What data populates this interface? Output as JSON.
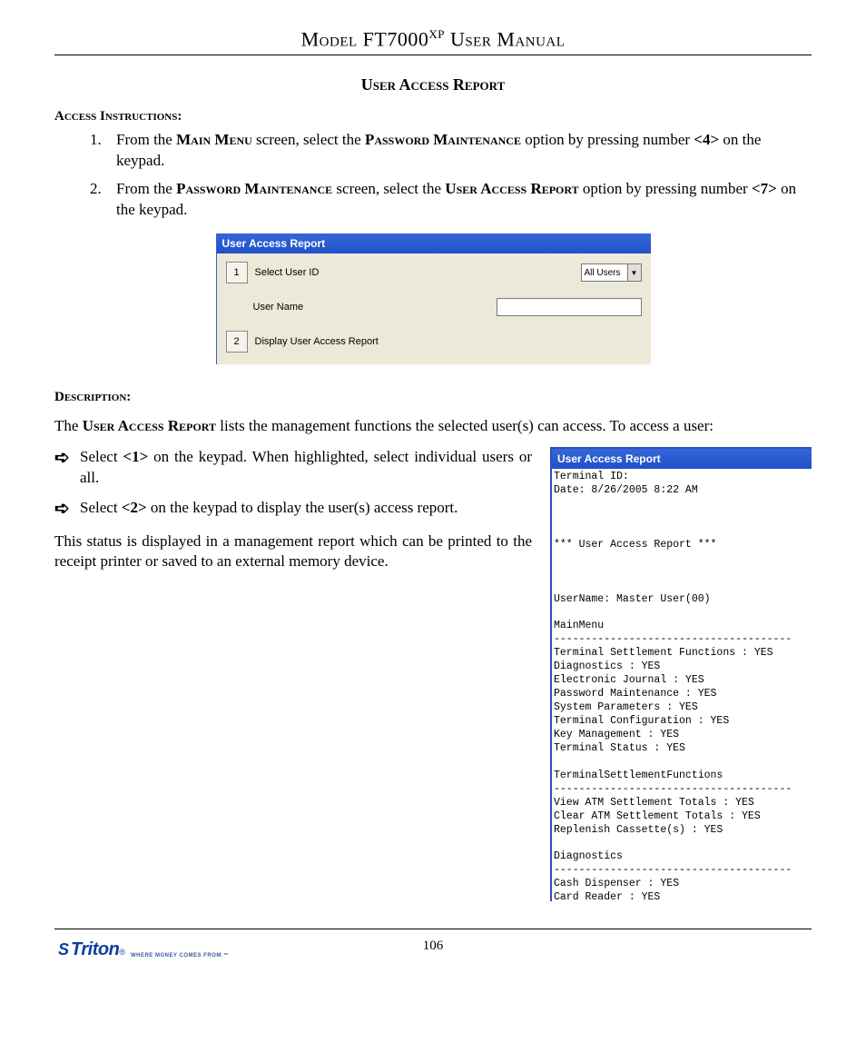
{
  "doc_title_prefix": "Model FT7000",
  "doc_title_super": "XP",
  "doc_title_suffix": " User Manual",
  "section_title": "User Access Report",
  "access_instructions_heading": "Access Instructions:",
  "instructions": [
    {
      "pre": "From the ",
      "sc1": "Main Menu",
      "mid1": " screen, select the ",
      "sc2": "Password Maintenance",
      "mid2": " option by pressing number ",
      "key": "<4>",
      "post": " on the keypad."
    },
    {
      "pre": "From the ",
      "sc1": "Password Maintenance",
      "mid1": " screen, select the ",
      "sc2": "User Access Report",
      "mid2": " option by pressing number ",
      "key": "<7>",
      "post": " on the keypad."
    }
  ],
  "dialog1": {
    "title": "User Access Report",
    "btn1_num": "1",
    "btn1_label": "Select User ID",
    "dropdown_value": "All Users",
    "username_label": "User Name",
    "username_value": "",
    "btn2_num": "2",
    "btn2_label": "Display User Access Report"
  },
  "description_heading": "Description:",
  "desc_line_pre": "The ",
  "desc_line_sc": "User Access Report",
  "desc_line_post": " lists the management functions the selected user(s) can access. To access a user:",
  "bullets": [
    {
      "pre": "Select ",
      "key": "<1>",
      "post": " on the keypad. When highlighted, select individual users or all."
    },
    {
      "pre": "Select ",
      "key": "<2>",
      "post": " on the keypad to display the user(s) access report."
    }
  ],
  "body_para": "This status is displayed in a management report  which can be printed to the receipt printer or saved to an external memory device.",
  "report2": {
    "title": "User Access Report",
    "body": "Terminal ID:\nDate: 8/26/2005 8:22 AM\n\n\n\n*** User Access Report ***\n\n\n\nUserName: Master User(00)\n\nMainMenu\n--------------------------------------\nTerminal Settlement Functions : YES\nDiagnostics : YES\nElectronic Journal : YES\nPassword Maintenance : YES\nSystem Parameters : YES\nTerminal Configuration : YES\nKey Management : YES\nTerminal Status : YES\n\nTerminalSettlementFunctions\n--------------------------------------\nView ATM Settlement Totals : YES\nClear ATM Settlement Totals : YES\nReplenish Cassette(s) : YES\n\nDiagnostics\n--------------------------------------\nCash Dispenser : YES\nCard Reader : YES"
  },
  "page_number": "106",
  "logo": {
    "mark": "S",
    "text": "Triton",
    "reg": "®",
    "tag": "WHERE MONEY COMES FROM.™"
  }
}
